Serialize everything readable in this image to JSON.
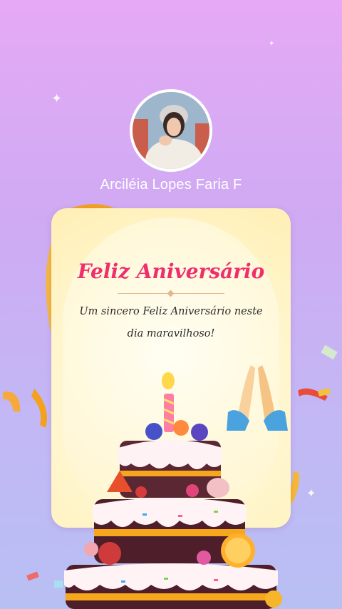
{
  "profile": {
    "name": "Arciléia Lopes Faria  F",
    "avatar_icon": "portrait-photo"
  },
  "card": {
    "title": "Feliz Aniversário",
    "message": "Um sincero Feliz Aniversário neste dia maravilhoso!"
  },
  "decorations": {
    "hands_icon": "folded-hands-emoji",
    "cake_icon": "birthday-cake",
    "ribbon_icon": "confetti-ribbon",
    "sparkle_icon": "sparkle"
  },
  "colors": {
    "title": "#ef2f6c",
    "background_top": "#e6a9f5",
    "background_bottom": "#b8bff3",
    "card": "#fff4c6"
  }
}
